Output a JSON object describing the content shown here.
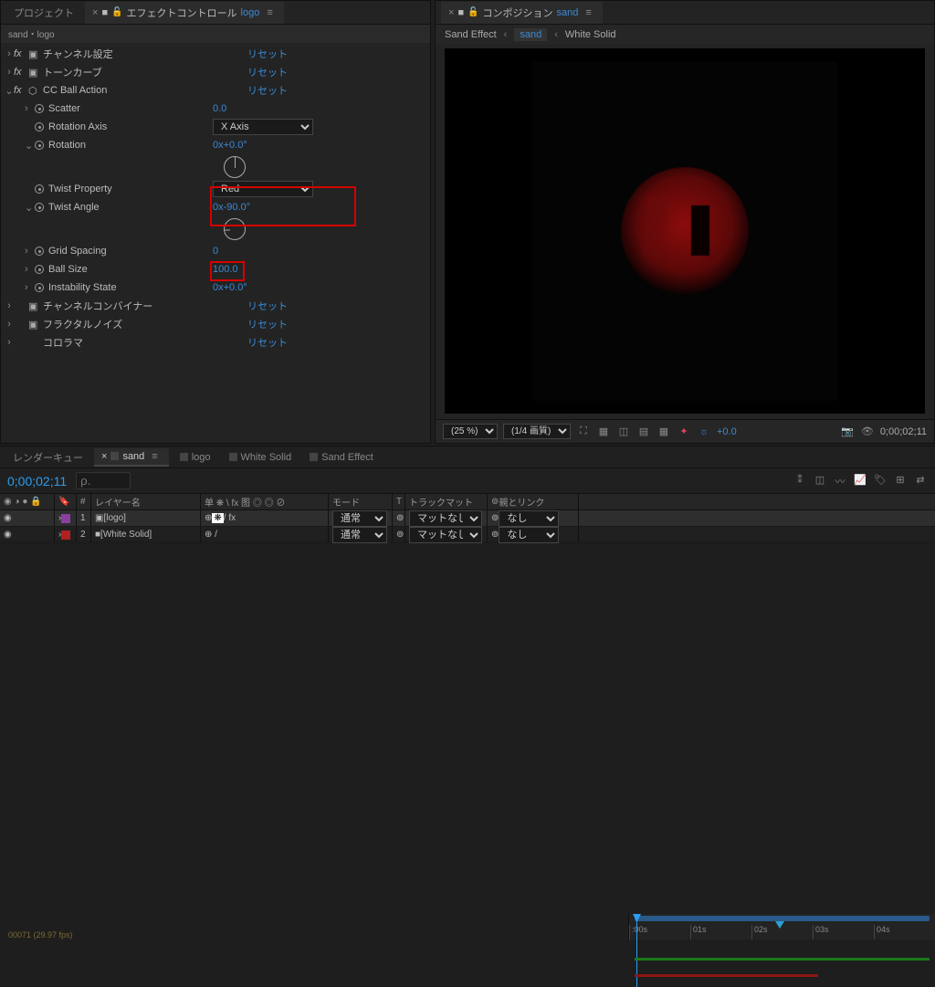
{
  "effects_panel": {
    "tabs": {
      "project": "プロジェクト",
      "ec_prefix": "エフェクトコントロール",
      "ec_target": "logo"
    },
    "breadcrumb": "sand・logo",
    "effects": [
      {
        "name": "チャンネル設定",
        "reset": "リセット"
      },
      {
        "name": "トーンカーブ",
        "reset": "リセット"
      },
      {
        "name": "CC Ball Action",
        "reset": "リセット"
      },
      {
        "name": "チャンネルコンバイナー",
        "reset": "リセット"
      },
      {
        "name": "フラクタルノイズ",
        "reset": "リセット"
      },
      {
        "name": "コロラマ",
        "reset": "リセット"
      }
    ],
    "ball_action": {
      "scatter": {
        "label": "Scatter",
        "value": "0.0"
      },
      "rotation_axis": {
        "label": "Rotation Axis",
        "value": "X Axis"
      },
      "rotation": {
        "label": "Rotation",
        "value": "0x+0.0°"
      },
      "twist_property": {
        "label": "Twist Property",
        "value": "Red"
      },
      "twist_angle": {
        "label": "Twist Angle",
        "value": "0x-90.0°"
      },
      "grid_spacing": {
        "label": "Grid Spacing",
        "value": "0"
      },
      "ball_size": {
        "label": "Ball Size",
        "value": "100.0"
      },
      "instability": {
        "label": "Instability State",
        "value": "0x+0.0°"
      }
    }
  },
  "comp_panel": {
    "tab_prefix": "コンポジション",
    "tab_target": "sand",
    "crumbs": [
      "Sand Effect",
      "sand",
      "White Solid"
    ],
    "footer": {
      "zoom": "(25 %)",
      "res": "(1/4 画質)",
      "exposure": "+0.0",
      "time": "0;00;02;11"
    }
  },
  "timeline": {
    "tabs": {
      "render_queue": "レンダーキュー",
      "sand": "sand",
      "logo": "logo",
      "white_solid": "White Solid",
      "sand_effect": "Sand Effect"
    },
    "timecode": "0;00;02;11",
    "timecode_sub": "00071 (29.97 fps)",
    "search_placeholder": "ρ.",
    "columns": {
      "num": "#",
      "layer_name": "レイヤー名",
      "switches": "单 ❋ \\ fx 图 ◎ ◎ ⊘",
      "mode": "モード",
      "trkmat_t": "T",
      "trkmat": "トラックマット",
      "parent": "親とリンク"
    },
    "layers": [
      {
        "num": "1",
        "name": "[logo]",
        "mode": "通常",
        "trkmat": "マットなし",
        "parent": "なし",
        "color": "#8a3fa0"
      },
      {
        "num": "2",
        "name": "[White Solid]",
        "mode": "通常",
        "trkmat": "マットなし",
        "parent": "なし",
        "color": "#b02020"
      }
    ],
    "ruler": [
      ":00s",
      "01s",
      "02s",
      "03s",
      "04s"
    ]
  }
}
